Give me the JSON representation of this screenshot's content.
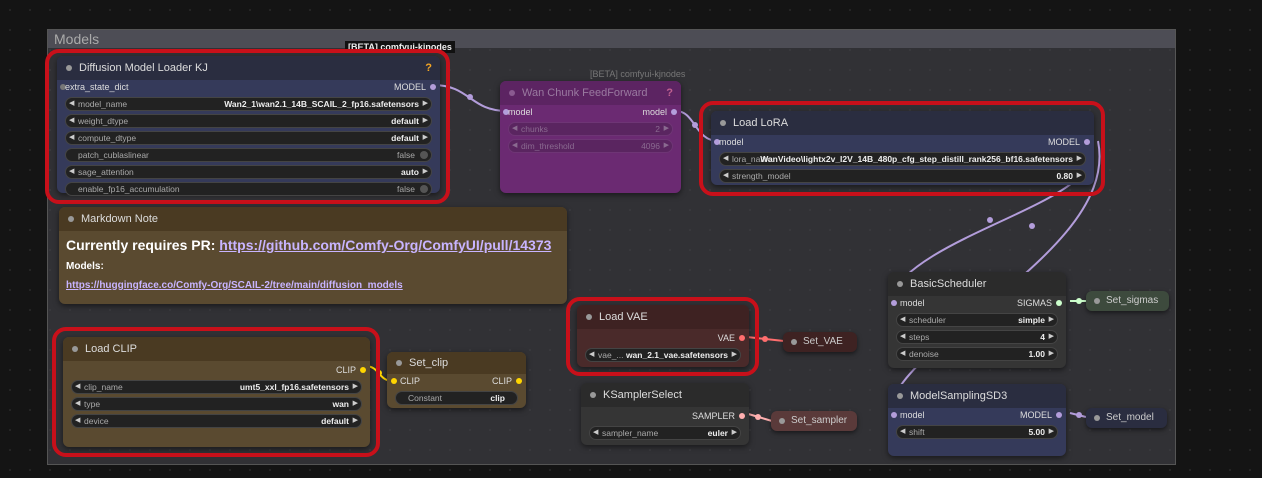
{
  "group": {
    "title": "Models"
  },
  "diffusion_loader": {
    "badge": "[BETA] comfyui-kjnodes",
    "title": "Diffusion Model Loader KJ",
    "badge_icon": "?",
    "input_label": "extra_state_dict",
    "output_label": "MODEL",
    "widgets": [
      {
        "label": "model_name",
        "value": "Wan2_1\\wan2.1_14B_SCAIL_2_fp16.safetensors"
      },
      {
        "label": "weight_dtype",
        "value": "default"
      },
      {
        "label": "compute_dtype",
        "value": "default"
      },
      {
        "label": "patch_cublaslinear",
        "value": "false"
      },
      {
        "label": "sage_attention",
        "value": "auto"
      },
      {
        "label": "enable_fp16_accumulation",
        "value": "false"
      }
    ]
  },
  "wan_chunk": {
    "badge": "[BETA] comfyui-kjnodes",
    "title": "Wan Chunk FeedForward",
    "badge_icon": "?",
    "input_label": "model",
    "output_label": "model",
    "widgets": [
      {
        "label": "chunks",
        "value": "2"
      },
      {
        "label": "dim_threshold",
        "value": "4096"
      }
    ]
  },
  "load_lora": {
    "title": "Load LoRA",
    "input_label": "model",
    "output_label": "MODEL",
    "widgets": [
      {
        "label": "lora_name",
        "value": "WanVideo\\lightx2v_I2V_14B_480p_cfg_step_distill_rank256_bf16.safetensors"
      },
      {
        "label": "strength_model",
        "value": "0.80"
      }
    ]
  },
  "markdown_note": {
    "title": "Markdown Note",
    "heading_prefix": "Currently requires PR: ",
    "heading_link": "https://github.com/Comfy-Org/ComfyUI/pull/14373",
    "models_label": "Models:",
    "models_link": "https://huggingface.co/Comfy-Org/SCAIL-2/tree/main/diffusion_models"
  },
  "load_clip": {
    "title": "Load CLIP",
    "output_label": "CLIP",
    "widgets": [
      {
        "label": "clip_name",
        "value": "umt5_xxl_fp16.safetensors"
      },
      {
        "label": "type",
        "value": "wan"
      },
      {
        "label": "device",
        "value": "default"
      }
    ]
  },
  "set_clip": {
    "title": "Set_clip",
    "input_label": "CLIP",
    "output_label": "CLIP",
    "widget": {
      "label": "Constant",
      "value": "clip"
    }
  },
  "load_vae": {
    "title": "Load VAE",
    "output_label": "VAE",
    "widget": {
      "label": "vae_...",
      "value": "wan_2.1_vae.safetensors"
    }
  },
  "set_vae": {
    "title": "Set_VAE"
  },
  "ksampler_select": {
    "title": "KSamplerSelect",
    "output_label": "SAMPLER",
    "widget": {
      "label": "sampler_name",
      "value": "euler"
    }
  },
  "set_sampler": {
    "title": "Set_sampler"
  },
  "basic_scheduler": {
    "title": "BasicScheduler",
    "input_label": "model",
    "output_label": "SIGMAS",
    "widgets": [
      {
        "label": "scheduler",
        "value": "simple"
      },
      {
        "label": "steps",
        "value": "4"
      },
      {
        "label": "denoise",
        "value": "1.00"
      }
    ]
  },
  "set_sigmas": {
    "title": "Set_sigmas"
  },
  "model_sampling": {
    "title": "ModelSamplingSD3",
    "input_label": "model",
    "output_label": "MODEL",
    "widget": {
      "label": "shift",
      "value": "5.00"
    }
  },
  "set_model": {
    "title": "Set_model"
  },
  "colors": {
    "highlight": "#c8101a",
    "model_wire": "#b39ddb",
    "clip_wire": "#ffd500",
    "vae_wire": "#ff6e6e",
    "sigmas_wire": "#cdffcd",
    "sampler_wire": "#ffb0b0"
  }
}
